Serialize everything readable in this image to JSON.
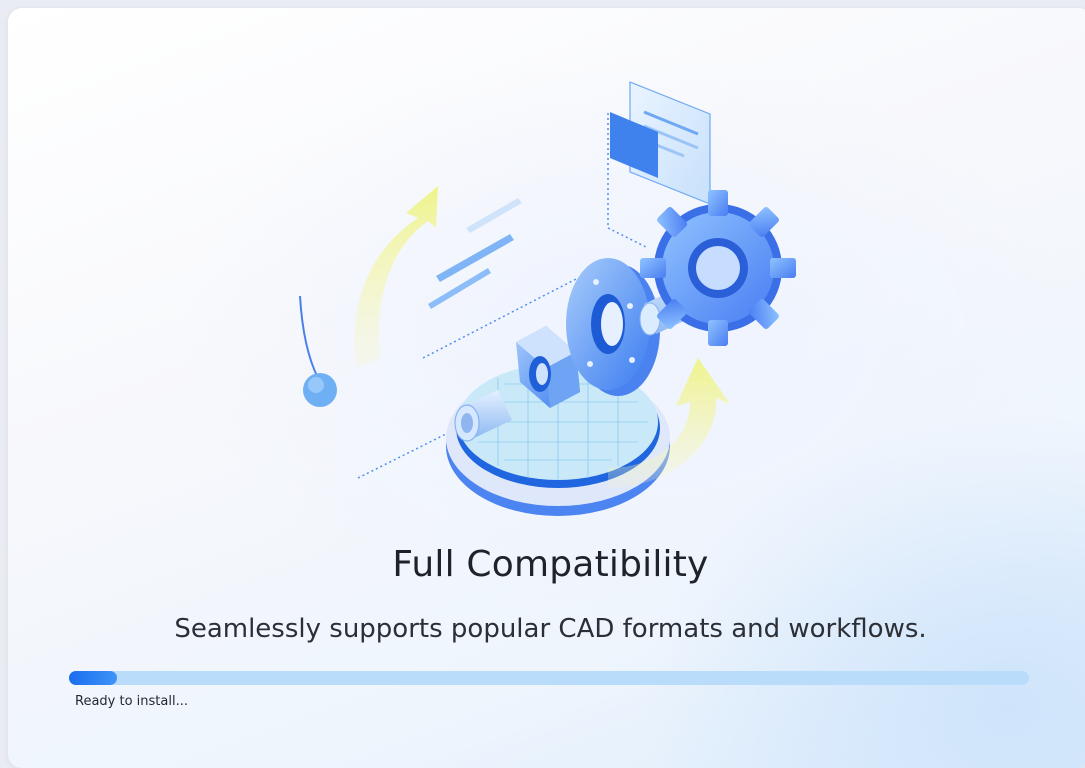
{
  "installer": {
    "feature_title": "Full Compatibility",
    "feature_description": "Seamlessly supports popular CAD formats and workflows.",
    "progress": {
      "fraction": 0.05,
      "status_text": "Ready to install..."
    }
  },
  "illustration": {
    "icon": "cad-parts-gear-illustration",
    "elements": [
      "gear-icon",
      "shaft-icon",
      "washer-icon",
      "hex-nut-icon",
      "pipe-icon",
      "document-panel-icon",
      "platform-disc-icon",
      "arrow-icon"
    ]
  },
  "colors": {
    "accent": "#1a6ef0",
    "track": "#b9dcfa",
    "title": "#1f2329"
  }
}
